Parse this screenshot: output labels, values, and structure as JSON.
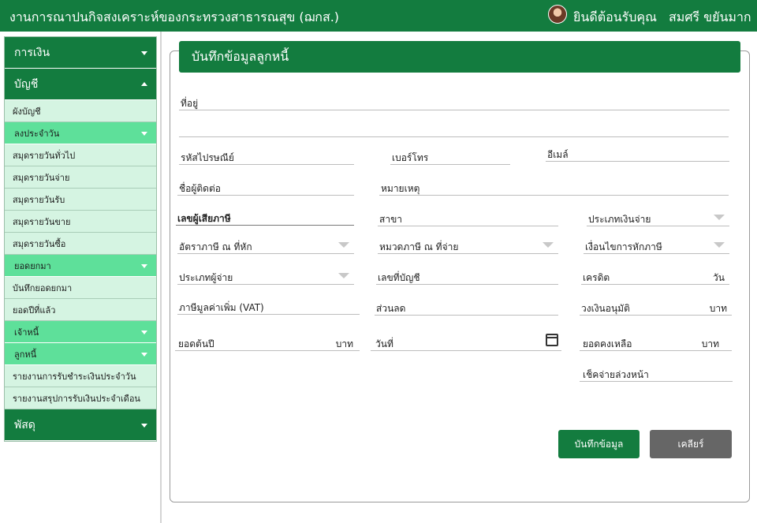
{
  "header": {
    "title": "งานการณาปนกิจสงเคราะห์ของกระทรวงสาธารณสุข (ฌกส.)",
    "welcome": "ยินดีต้อนรับคุณ",
    "username": "สมศรี ขยันมาก"
  },
  "sidebar": {
    "items": [
      {
        "label": "การเงิน",
        "kind": "main",
        "caret": "down"
      },
      {
        "label": "บัญชี",
        "kind": "main",
        "caret": "up"
      },
      {
        "label": "ผังบัญชี",
        "kind": "sub"
      },
      {
        "label": "ลงประจำวัน",
        "kind": "group",
        "caret": "down"
      },
      {
        "label": "สมุดรายวันทั่วไป",
        "kind": "sub"
      },
      {
        "label": "สมุดรายวันจ่าย",
        "kind": "sub"
      },
      {
        "label": "สมุดรายวันรับ",
        "kind": "sub"
      },
      {
        "label": "สมุดรายวันขาย",
        "kind": "sub"
      },
      {
        "label": "สมุดรายวันซื้อ",
        "kind": "sub"
      },
      {
        "label": "ยอดยกมา",
        "kind": "group",
        "caret": "down"
      },
      {
        "label": "บันทึกยอดยกมา",
        "kind": "sub"
      },
      {
        "label": "ยอดปีที่แล้ว",
        "kind": "sub"
      },
      {
        "label": "เจ้าหนี้",
        "kind": "group",
        "caret": "down"
      },
      {
        "label": "ลูกหนี้",
        "kind": "group",
        "caret": "down"
      },
      {
        "label": "รายงานการรับชำระเงินประจำวัน",
        "kind": "sub"
      },
      {
        "label": "รายงานสรุปการรับเงินประจำเดือน",
        "kind": "sub"
      },
      {
        "label": "พัสดุ",
        "kind": "main",
        "caret": "down"
      }
    ]
  },
  "form": {
    "title": "บันทึกข้อมูลลูกหนี้",
    "address": "ที่อยู่",
    "postal_code": "รหัสไปรษณีย์",
    "phone": "เบอร์โทร",
    "email": "อีเมล์",
    "contact_name": "ชื่อผู้ติดต่อ",
    "note": "หมายเหตุ",
    "tax_id": "เลขผู้เสียภาษี",
    "branch": "สาขา",
    "payment_type": "ประเภทเงินจ่าย",
    "withholding_rate": "อัตราภาษี ณ ที่หัก",
    "withholding_category": "หมวดภาษี ณ ที่จ่าย",
    "withholding_condition": "เงื่อนไขการหักภาษี",
    "payer_type": "ประเภทผู้จ่าย",
    "account_no": "เลขที่บัญชี",
    "credit": "เครดิต",
    "credit_unit": "วัน",
    "vat": "ภาษีมูลค่าเพิ่ม (VAT)",
    "discount": "ส่วนลด",
    "approved_limit": "วงเงินอนุมัติ",
    "approved_limit_unit": "บาท",
    "opening_balance": "ยอดต้นปี",
    "opening_balance_unit": "บาท",
    "date": "วันที่",
    "remaining_balance": "ยอดคงเหลือ",
    "remaining_balance_unit": "บาท",
    "post_dated_cheque": "เช็คจ่ายล่วงหน้า",
    "save_label": "บันทึกข้อมูล",
    "clear_label": "เคลียร์"
  }
}
